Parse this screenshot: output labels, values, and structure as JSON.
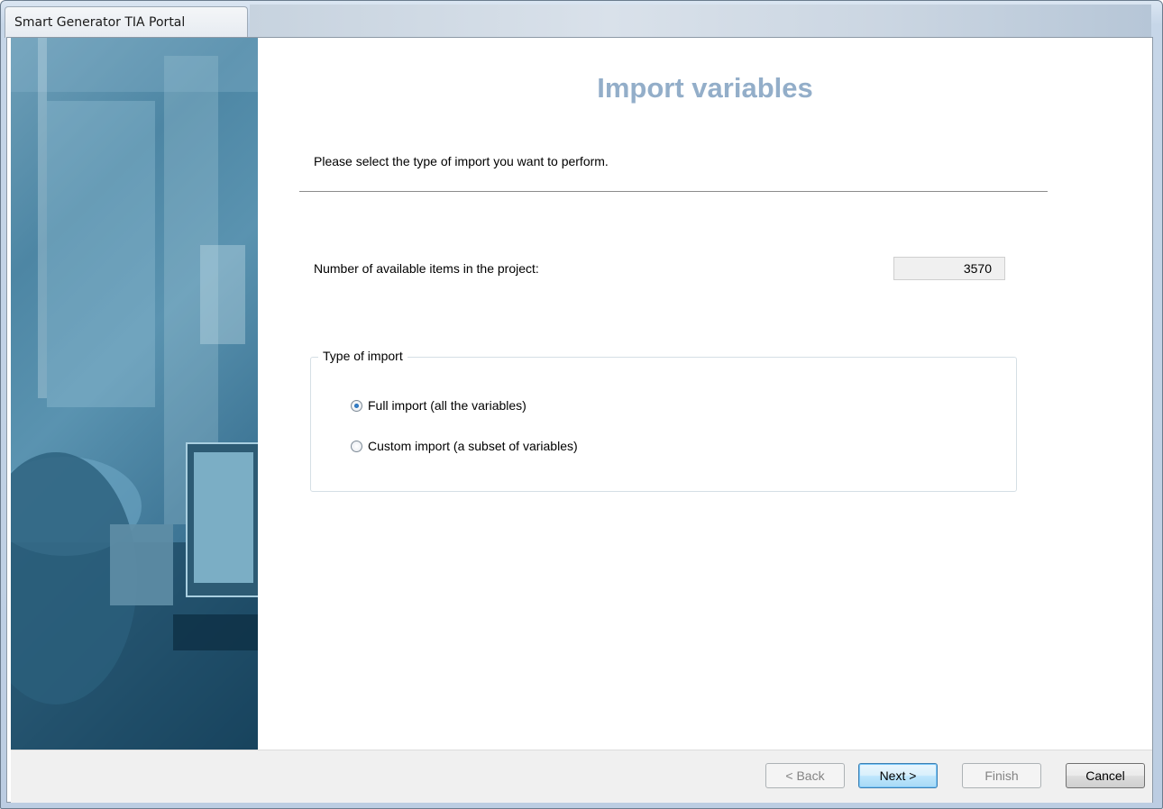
{
  "window": {
    "title": "Smart Generator TIA Portal"
  },
  "page": {
    "heading": "Import variables",
    "subtitle": "Please select the type of import you want to perform."
  },
  "items": {
    "label": "Number of available items in the project:",
    "count": "3570"
  },
  "import_type": {
    "legend": "Type of import",
    "options": [
      {
        "label": "Full import (all the variables)",
        "selected": true
      },
      {
        "label": "Custom import (a subset of variables)",
        "selected": false
      }
    ]
  },
  "buttons": {
    "back": "< Back",
    "next": "Next >",
    "finish": "Finish",
    "cancel": "Cancel"
  },
  "colors": {
    "heading": "#93aec9",
    "default_button_border": "#3c7fb1"
  }
}
